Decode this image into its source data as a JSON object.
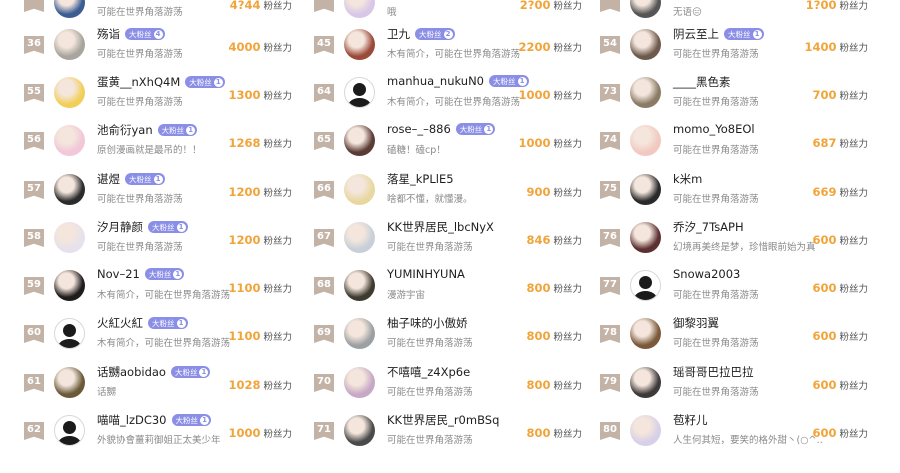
{
  "columns": [
    {
      "rows": [
        {
          "rank": "",
          "name": "",
          "badge": "",
          "level": "",
          "desc": "可能在世界角落游荡",
          "fans": "4?44",
          "fans_unit": "粉丝力",
          "avatar": "#3c5d93"
        },
        {
          "rank": "36",
          "name": "殇诣",
          "badge": "大粉丝",
          "level": "4",
          "desc": "可能在世界角落游荡",
          "fans": "4000",
          "fans_unit": "粉丝力",
          "avatar": "#a8a59e"
        },
        {
          "rank": "55",
          "name": "蛋黄__nXhQ4M",
          "badge": "大粉丝",
          "level": "1",
          "desc": "可能在世界角落游荡",
          "fans": "1300",
          "fans_unit": "粉丝力",
          "avatar": "#f2cf5a"
        },
        {
          "rank": "56",
          "name": "池俞衍yan",
          "badge": "大粉丝",
          "level": "1",
          "desc": "原创漫画就是最吊的！！",
          "fans": "1268",
          "fans_unit": "粉丝力",
          "avatar": "#f2c7d9"
        },
        {
          "rank": "57",
          "name": "谌煜",
          "badge": "大粉丝",
          "level": "1",
          "desc": "可能在世界角落游荡",
          "fans": "1200",
          "fans_unit": "粉丝力",
          "avatar": "#2b2b2b"
        },
        {
          "rank": "58",
          "name": "汐月静颜",
          "badge": "大粉丝",
          "level": "1",
          "desc": "可能在世界角落游荡",
          "fans": "1200",
          "fans_unit": "粉丝力",
          "avatar": "#e6e1ec"
        },
        {
          "rank": "59",
          "name": "Nov–21",
          "badge": "大粉丝",
          "level": "1",
          "desc": "木有简介，可能在世界角落游荡",
          "fans": "1100",
          "fans_unit": "粉丝力",
          "avatar": "#1f1c1c"
        },
        {
          "rank": "60",
          "name": "火紅火紅",
          "badge": "大粉丝",
          "level": "1",
          "desc": "木有简介，可能在世界角落游荡",
          "fans": "1100",
          "fans_unit": "粉丝力",
          "avatar": "default"
        },
        {
          "rank": "61",
          "name": "话嬲aobidao",
          "badge": "大粉丝",
          "level": "1",
          "desc": "话嬲",
          "fans": "1028",
          "fans_unit": "粉丝力",
          "avatar": "#6b5a3a"
        },
        {
          "rank": "62",
          "name": "喵喵_lzDC30",
          "badge": "大粉丝",
          "level": "1",
          "desc": "外貌协會薑莉御姐正太美少年",
          "fans": "1000",
          "fans_unit": "粉丝力",
          "avatar": "default"
        }
      ]
    },
    {
      "rows": [
        {
          "rank": "",
          "name": "",
          "badge": "",
          "level": "",
          "desc": "哦",
          "fans": "2?00",
          "fans_unit": "粉丝力",
          "avatar": "#d9c7e8"
        },
        {
          "rank": "45",
          "name": "卫九",
          "badge": "大粉丝",
          "level": "2",
          "desc": "木有简介，可能在世界角落游荡",
          "fans": "2200",
          "fans_unit": "粉丝力",
          "avatar": "#9b4a3a"
        },
        {
          "rank": "64",
          "name": "manhua_nukuN0",
          "badge": "大粉丝",
          "level": "1",
          "desc": "木有简介，可能在世界角落游荡",
          "fans": "1000",
          "fans_unit": "粉丝力",
          "avatar": "default"
        },
        {
          "rank": "65",
          "name": "rose–_–886",
          "badge": "大粉丝",
          "level": "1",
          "desc": "磕糖！磕cp！",
          "fans": "1000",
          "fans_unit": "粉丝力",
          "avatar": "#5a3b35"
        },
        {
          "rank": "66",
          "name": "落星_kPLlE5",
          "badge": "",
          "level": "",
          "desc": "啥都不懂，就懂漫。",
          "fans": "900",
          "fans_unit": "粉丝力",
          "avatar": "#e8d8a0"
        },
        {
          "rank": "67",
          "name": "KK世界居民_lbcNyX",
          "badge": "",
          "level": "",
          "desc": "可能在世界角落游荡",
          "fans": "846",
          "fans_unit": "粉丝力",
          "avatar": "#c9cfd8"
        },
        {
          "rank": "68",
          "name": "YUMINHYUNA",
          "badge": "",
          "level": "",
          "desc": "漫游宇宙",
          "fans": "800",
          "fans_unit": "粉丝力",
          "avatar": "#3d3a30"
        },
        {
          "rank": "69",
          "name": "柚子味的小傲娇",
          "badge": "",
          "level": "",
          "desc": "可能在世界角落游荡",
          "fans": "800",
          "fans_unit": "粉丝力",
          "avatar": "#9da0a3"
        },
        {
          "rank": "70",
          "name": "不嘻嘻_z4Xp6e",
          "badge": "",
          "level": "",
          "desc": "可能在世界角落游荡",
          "fans": "800",
          "fans_unit": "粉丝力",
          "avatar": "#c7a9c7"
        },
        {
          "rank": "71",
          "name": "KK世界居民_r0mBSq",
          "badge": "",
          "level": "",
          "desc": "可能在世界角落游荡",
          "fans": "800",
          "fans_unit": "粉丝力",
          "avatar": "#4a4a4a"
        }
      ]
    },
    {
      "rows": [
        {
          "rank": "",
          "name": "",
          "badge": "",
          "level": "",
          "desc": "无语😑",
          "fans": "1?00",
          "fans_unit": "粉丝力",
          "avatar": "#555555"
        },
        {
          "rank": "54",
          "name": "阴云至上",
          "badge": "大粉丝",
          "level": "1",
          "desc": "可能在世界角落游荡",
          "fans": "1400",
          "fans_unit": "粉丝力",
          "avatar": "#6e5a4c"
        },
        {
          "rank": "73",
          "name": "____黑色素",
          "badge": "",
          "level": "",
          "desc": "可能在世界角落游荡",
          "fans": "700",
          "fans_unit": "粉丝力",
          "avatar": "#8a7a66"
        },
        {
          "rank": "74",
          "name": "momo_Yo8EOl",
          "badge": "",
          "level": "",
          "desc": "可能在世界角落游荡",
          "fans": "687",
          "fans_unit": "粉丝力",
          "avatar": "#f1c9c0"
        },
        {
          "rank": "75",
          "name": "k米m",
          "badge": "",
          "level": "",
          "desc": "可能在世界角落游荡",
          "fans": "669",
          "fans_unit": "粉丝力",
          "avatar": "#2a2a2a"
        },
        {
          "rank": "76",
          "name": "乔汐_7TsAPH",
          "badge": "",
          "level": "",
          "desc": "幻境再美终是梦，珍惜眼前始为真",
          "fans": "600",
          "fans_unit": "粉丝力",
          "avatar": "#5c3030"
        },
        {
          "rank": "77",
          "name": "Snowa2003",
          "badge": "",
          "level": "",
          "desc": "可能在世界角落游荡",
          "fans": "600",
          "fans_unit": "粉丝力",
          "avatar": "default"
        },
        {
          "rank": "78",
          "name": "御黎羽翼",
          "badge": "",
          "level": "",
          "desc": "可能在世界角落游荡",
          "fans": "600",
          "fans_unit": "粉丝力",
          "avatar": "#7a5a3a"
        },
        {
          "rank": "79",
          "name": "瑶哥哥巴拉巴拉",
          "badge": "",
          "level": "",
          "desc": "可能在世界角落游荡",
          "fans": "600",
          "fans_unit": "粉丝力",
          "avatar": "#3e3a3a"
        },
        {
          "rank": "80",
          "name": "苞籽儿",
          "badge": "",
          "level": "",
          "desc": "人生何其短，要笑的格外甜丶(○^…",
          "fans": "600",
          "fans_unit": "粉丝力",
          "avatar": "#d8d0e8"
        }
      ]
    }
  ]
}
